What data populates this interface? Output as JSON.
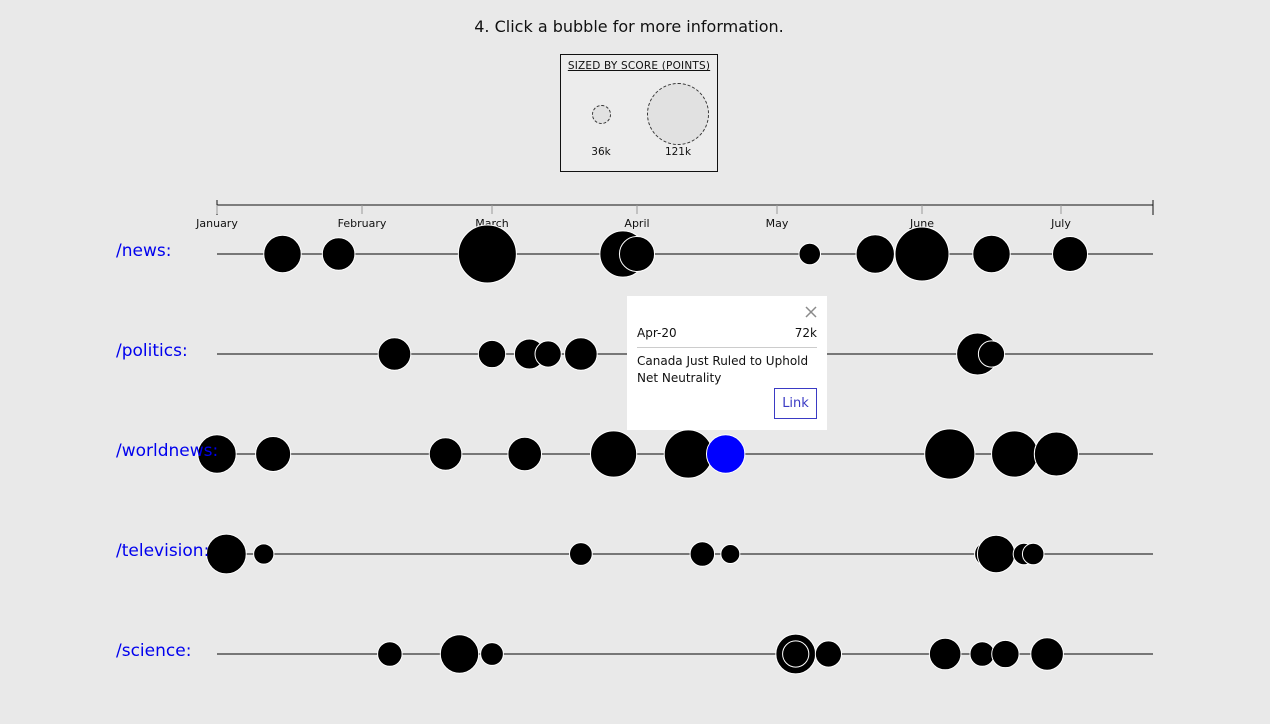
{
  "instruction": "4. Click a bubble for more information.",
  "legend": {
    "title": "SIZED BY SCORE (POINTS)",
    "small_label": "36k",
    "large_label": "121k"
  },
  "popup": {
    "date": "Apr-20",
    "score": "72k",
    "title": "Canada Just Ruled to Uphold Net Neutrality",
    "link_label": "Link",
    "close_icon": "close-icon"
  },
  "colors": {
    "background": "#e9e9e9",
    "bubble": "#000000",
    "selected_bubble": "#0000ff",
    "subreddit_link": "#0000ee"
  },
  "chart_data": {
    "type": "scatter",
    "x_axis": {
      "months": [
        "January",
        "February",
        "March",
        "April",
        "May",
        "June",
        "July"
      ]
    },
    "size_scale": {
      "min_score_k": 36,
      "max_score_k": 121
    },
    "rows": [
      {
        "label": "/news:",
        "bubbles": [
          {
            "date": "2017-01-15",
            "score_k": 70
          },
          {
            "date": "2017-01-27",
            "score_k": 60
          },
          {
            "date": "2017-02-28",
            "score_k": 121
          },
          {
            "date": "2017-03-29",
            "score_k": 90
          },
          {
            "date": "2017-04-01",
            "score_k": 65
          },
          {
            "date": "2017-05-08",
            "score_k": 40
          },
          {
            "date": "2017-05-22",
            "score_k": 72
          },
          {
            "date": "2017-06-01",
            "score_k": 110
          },
          {
            "date": "2017-06-16",
            "score_k": 70
          },
          {
            "date": "2017-07-07",
            "score_k": 65
          }
        ]
      },
      {
        "label": "/politics:",
        "bubbles": [
          {
            "date": "2017-02-08",
            "score_k": 60
          },
          {
            "date": "2017-03-01",
            "score_k": 50
          },
          {
            "date": "2017-03-09",
            "score_k": 55
          },
          {
            "date": "2017-03-13",
            "score_k": 48
          },
          {
            "date": "2017-03-20",
            "score_k": 60
          },
          {
            "date": "2017-04-29",
            "score_k": 60
          },
          {
            "date": "2017-06-13",
            "score_k": 80
          },
          {
            "date": "2017-06-16",
            "score_k": 48
          }
        ]
      },
      {
        "label": "/worldnews:",
        "bubbles": [
          {
            "date": "2017-01-01",
            "score_k": 72
          },
          {
            "date": "2017-01-13",
            "score_k": 65
          },
          {
            "date": "2017-02-19",
            "score_k": 60
          },
          {
            "date": "2017-03-08",
            "score_k": 62
          },
          {
            "date": "2017-03-27",
            "score_k": 90
          },
          {
            "date": "2017-04-12",
            "score_k": 95
          },
          {
            "date": "2017-04-20",
            "score_k": 72,
            "selected": true
          },
          {
            "date": "2017-06-07",
            "score_k": 100
          },
          {
            "date": "2017-06-21",
            "score_k": 90
          },
          {
            "date": "2017-06-30",
            "score_k": 85
          }
        ]
      },
      {
        "label": "/television:",
        "bubbles": [
          {
            "date": "2017-01-03",
            "score_k": 75
          },
          {
            "date": "2017-01-11",
            "score_k": 38
          },
          {
            "date": "2017-03-20",
            "score_k": 42
          },
          {
            "date": "2017-04-15",
            "score_k": 45
          },
          {
            "date": "2017-04-21",
            "score_k": 36
          },
          {
            "date": "2017-06-15",
            "score_k": 45
          },
          {
            "date": "2017-06-17",
            "score_k": 70
          },
          {
            "date": "2017-06-23",
            "score_k": 40
          },
          {
            "date": "2017-06-25",
            "score_k": 40
          }
        ]
      },
      {
        "label": "/science:",
        "bubbles": [
          {
            "date": "2017-02-07",
            "score_k": 45
          },
          {
            "date": "2017-02-22",
            "score_k": 72
          },
          {
            "date": "2017-03-01",
            "score_k": 42
          },
          {
            "date": "2017-05-05",
            "score_k": 75
          },
          {
            "date": "2017-05-05",
            "score_k": 48
          },
          {
            "date": "2017-05-12",
            "score_k": 48
          },
          {
            "date": "2017-06-06",
            "score_k": 58
          },
          {
            "date": "2017-06-14",
            "score_k": 45
          },
          {
            "date": "2017-06-19",
            "score_k": 50
          },
          {
            "date": "2017-06-28",
            "score_k": 60
          }
        ]
      }
    ]
  }
}
